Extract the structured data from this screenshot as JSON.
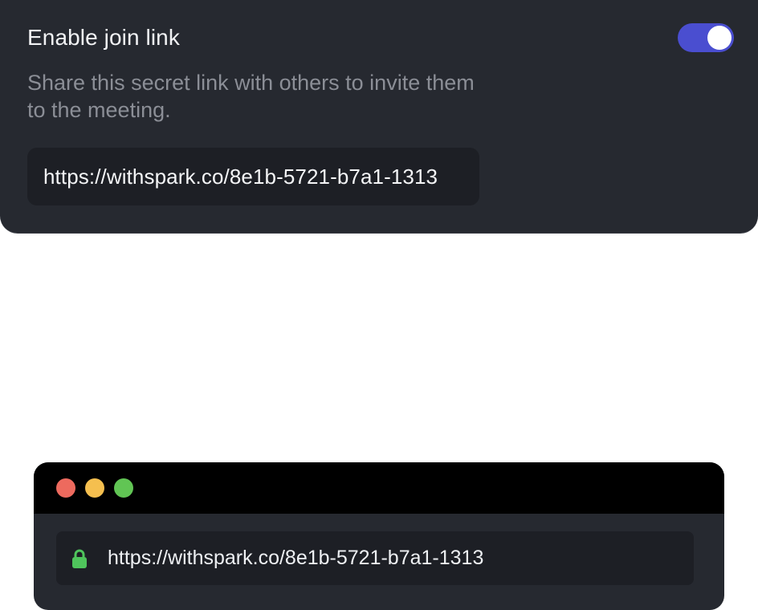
{
  "join_link": {
    "title": "Enable join link",
    "enabled": true,
    "description": "Share this secret link with others to invite them to the meeting.",
    "link": "https://withspark.co/8e1b-5721-b7a1-1313",
    "toggle_color": "#4a4ed0"
  },
  "browser": {
    "window_controls": {
      "close_color": "#ed6a5e",
      "minimize_color": "#f5bf4f",
      "maximize_color": "#61c554"
    },
    "address_url": "https://withspark.co/8e1b-5721-b7a1-1313",
    "secure_icon": "lock-icon",
    "lock_color": "#4fc45c"
  }
}
